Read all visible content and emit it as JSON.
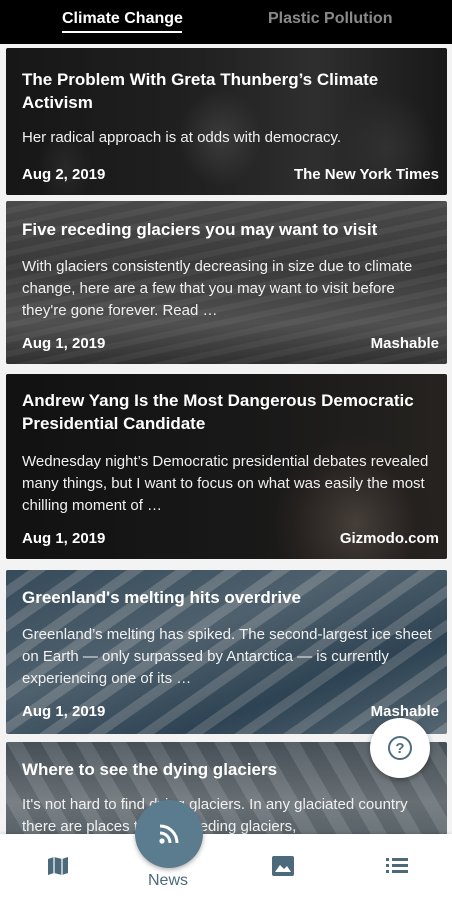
{
  "tabs": [
    {
      "label": "Climate Change",
      "active": true
    },
    {
      "label": "Plastic Pollution",
      "active": false
    }
  ],
  "articles": [
    {
      "title": "The Problem With Greta Thunberg’s Climate Activism",
      "description": "Her radical approach is at odds with democracy.",
      "date": "Aug 2, 2019",
      "source": "The New York Times"
    },
    {
      "title": "Five receding glaciers you may want to visit",
      "description": "With glaciers consistently decreasing in size due to climate change, here are a few that you may want to visit before they're gone forever. Read …",
      "date": "Aug 1, 2019",
      "source": "Mashable"
    },
    {
      "title": "Andrew Yang Is the Most Dangerous Democratic Presidential Candidate",
      "description": "Wednesday night’s Democratic presidential debates revealed many things, but I want to focus on what was easily the most chilling moment of …",
      "date": "Aug 1, 2019",
      "source": "Gizmodo.com"
    },
    {
      "title": "Greenland's melting hits overdrive",
      "description": "Greenland’s melting has spiked. The second-largest ice sheet on Earth — only surpassed by Antarctica — is currently experiencing one of its …",
      "date": "Aug 1, 2019",
      "source": "Mashable"
    },
    {
      "title": "Where to see the dying glaciers",
      "description": "It's not hard to find dying glaciers. In any glaciated country there are places to see receding glaciers,",
      "date": "",
      "source": ""
    }
  ],
  "help_button": {
    "icon": "question-icon",
    "label": "?"
  },
  "bottom_nav": {
    "map": {
      "icon": "map-icon"
    },
    "news": {
      "icon": "rss-icon",
      "label": "News"
    },
    "gallery": {
      "icon": "image-icon"
    },
    "list": {
      "icon": "list-icon"
    }
  },
  "colors": {
    "accent": "#5b7b8e",
    "topbar": "#000000",
    "inactive_tab": "#8a8a8a"
  }
}
